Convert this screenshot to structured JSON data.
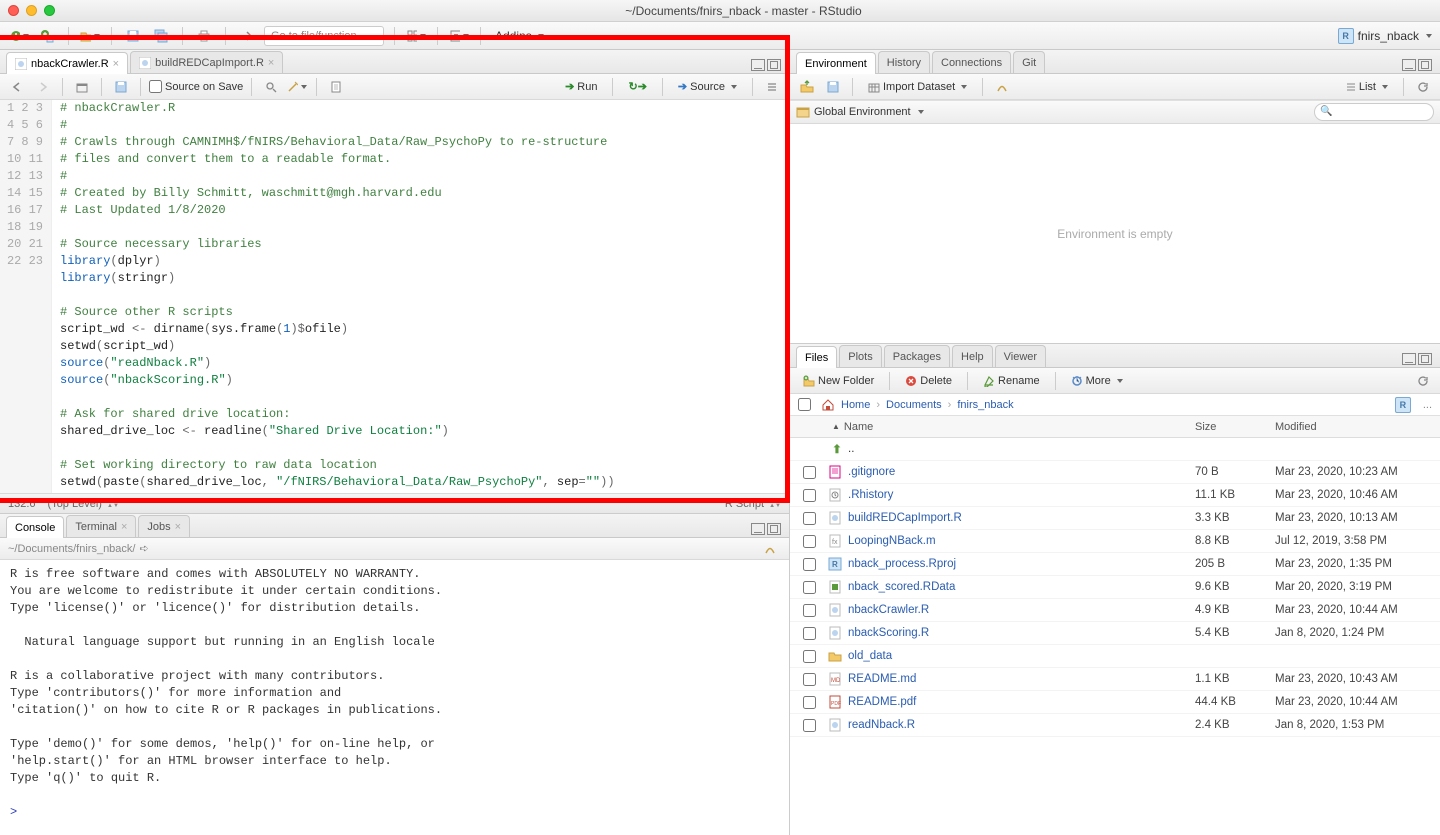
{
  "window": {
    "title": "~/Documents/fnirs_nback - master - RStudio"
  },
  "toolbar": {
    "gotofile_placeholder": "Go to file/function",
    "addins_label": "Addins",
    "project_name": "fnirs_nback"
  },
  "source": {
    "tabs": [
      {
        "label": "nbackCrawler.R",
        "active": true
      },
      {
        "label": "buildREDCapImport.R",
        "active": false
      }
    ],
    "sourceonsave_label": "Source on Save",
    "run_label": "Run",
    "source_label": "Source",
    "cursor_pos": "132:6",
    "scope_label": "(Top Level)",
    "filetype_label": "R Script",
    "lines": [
      {
        "n": 1,
        "tokens": [
          [
            "comment",
            "# nbackCrawler.R"
          ]
        ]
      },
      {
        "n": 2,
        "tokens": [
          [
            "comment",
            "#"
          ]
        ]
      },
      {
        "n": 3,
        "tokens": [
          [
            "comment",
            "# Crawls through CAMNIMH$/fNIRS/Behavioral_Data/Raw_PsychoPy to re-structure"
          ]
        ]
      },
      {
        "n": 4,
        "tokens": [
          [
            "comment",
            "# files and convert them to a readable format."
          ]
        ]
      },
      {
        "n": 5,
        "tokens": [
          [
            "comment",
            "#"
          ]
        ]
      },
      {
        "n": 6,
        "tokens": [
          [
            "comment",
            "# Created by Billy Schmitt, waschmitt@mgh.harvard.edu"
          ]
        ]
      },
      {
        "n": 7,
        "tokens": [
          [
            "comment",
            "# Last Updated 1/8/2020"
          ]
        ]
      },
      {
        "n": 8,
        "tokens": []
      },
      {
        "n": 9,
        "tokens": [
          [
            "comment",
            "# Source necessary libraries"
          ]
        ]
      },
      {
        "n": 10,
        "tokens": [
          [
            "keyword",
            "library"
          ],
          [
            "op",
            "("
          ],
          [
            "fn",
            "dplyr"
          ],
          [
            "op",
            ")"
          ]
        ]
      },
      {
        "n": 11,
        "tokens": [
          [
            "keyword",
            "library"
          ],
          [
            "op",
            "("
          ],
          [
            "fn",
            "stringr"
          ],
          [
            "op",
            ")"
          ]
        ]
      },
      {
        "n": 12,
        "tokens": []
      },
      {
        "n": 13,
        "tokens": [
          [
            "comment",
            "# Source other R scripts"
          ]
        ]
      },
      {
        "n": 14,
        "tokens": [
          [
            "fn",
            "script_wd "
          ],
          [
            "op",
            "<- "
          ],
          [
            "fn",
            "dirname"
          ],
          [
            "op",
            "("
          ],
          [
            "fn",
            "sys.frame"
          ],
          [
            "op",
            "("
          ],
          [
            "num",
            "1"
          ],
          [
            "op",
            ")"
          ],
          [
            "op",
            "$"
          ],
          [
            "fn",
            "ofile"
          ],
          [
            "op",
            ")"
          ]
        ]
      },
      {
        "n": 15,
        "tokens": [
          [
            "fn",
            "setwd"
          ],
          [
            "op",
            "("
          ],
          [
            "fn",
            "script_wd"
          ],
          [
            "op",
            ")"
          ]
        ]
      },
      {
        "n": 16,
        "tokens": [
          [
            "keyword",
            "source"
          ],
          [
            "op",
            "("
          ],
          [
            "string",
            "\"readNback.R\""
          ],
          [
            "op",
            ")"
          ]
        ]
      },
      {
        "n": 17,
        "tokens": [
          [
            "keyword",
            "source"
          ],
          [
            "op",
            "("
          ],
          [
            "string",
            "\"nbackScoring.R\""
          ],
          [
            "op",
            ")"
          ]
        ]
      },
      {
        "n": 18,
        "tokens": []
      },
      {
        "n": 19,
        "tokens": [
          [
            "comment",
            "# Ask for shared drive location:"
          ]
        ]
      },
      {
        "n": 20,
        "tokens": [
          [
            "fn",
            "shared_drive_loc "
          ],
          [
            "op",
            "<- "
          ],
          [
            "fn",
            "readline"
          ],
          [
            "op",
            "("
          ],
          [
            "string",
            "\"Shared Drive Location:\""
          ],
          [
            "op",
            ")"
          ]
        ]
      },
      {
        "n": 21,
        "tokens": []
      },
      {
        "n": 22,
        "tokens": [
          [
            "comment",
            "# Set working directory to raw data location"
          ]
        ]
      },
      {
        "n": 23,
        "tokens": [
          [
            "fn",
            "setwd"
          ],
          [
            "op",
            "("
          ],
          [
            "fn",
            "paste"
          ],
          [
            "op",
            "("
          ],
          [
            "fn",
            "shared_drive_loc"
          ],
          [
            "op",
            ", "
          ],
          [
            "string",
            "\"/fNIRS/Behavioral_Data/Raw_PsychoPy\""
          ],
          [
            "op",
            ", "
          ],
          [
            "fn",
            "sep"
          ],
          [
            "op",
            "="
          ],
          [
            "string",
            "\"\""
          ],
          [
            "op",
            "))"
          ]
        ]
      }
    ]
  },
  "console": {
    "tabs": [
      {
        "label": "Console",
        "active": true
      },
      {
        "label": "Terminal",
        "active": false
      },
      {
        "label": "Jobs",
        "active": false
      }
    ],
    "path": "~/Documents/fnirs_nback/",
    "body": "R is free software and comes with ABSOLUTELY NO WARRANTY.\nYou are welcome to redistribute it under certain conditions.\nType 'license()' or 'licence()' for distribution details.\n\n  Natural language support but running in an English locale\n\nR is a collaborative project with many contributors.\nType 'contributors()' for more information and\n'citation()' on how to cite R or R packages in publications.\n\nType 'demo()' for some demos, 'help()' for on-line help, or\n'help.start()' for an HTML browser interface to help.\nType 'q()' to quit R.\n",
    "prompt": "> "
  },
  "env": {
    "tabs": [
      {
        "label": "Environment",
        "active": true
      },
      {
        "label": "History",
        "active": false
      },
      {
        "label": "Connections",
        "active": false
      },
      {
        "label": "Git",
        "active": false
      }
    ],
    "import_label": "Import Dataset",
    "list_label": "List",
    "scope_label": "Global Environment",
    "empty_text": "Environment is empty"
  },
  "files": {
    "tabs": [
      {
        "label": "Files",
        "active": true
      },
      {
        "label": "Plots",
        "active": false
      },
      {
        "label": "Packages",
        "active": false
      },
      {
        "label": "Help",
        "active": false
      },
      {
        "label": "Viewer",
        "active": false
      }
    ],
    "newfolder_label": "New Folder",
    "delete_label": "Delete",
    "rename_label": "Rename",
    "more_label": "More",
    "breadcrumb": [
      "Home",
      "Documents",
      "fnirs_nback"
    ],
    "header": {
      "name": "Name",
      "size": "Size",
      "modified": "Modified"
    },
    "uprow": "..",
    "rows": [
      {
        "icon": "txt",
        "name": ".gitignore",
        "size": "70 B",
        "modified": "Mar 23, 2020, 10:23 AM"
      },
      {
        "icon": "rhist",
        "name": ".Rhistory",
        "size": "11.1 KB",
        "modified": "Mar 23, 2020, 10:46 AM"
      },
      {
        "icon": "r",
        "name": "buildREDCapImport.R",
        "size": "3.3 KB",
        "modified": "Mar 23, 2020, 10:13 AM"
      },
      {
        "icon": "m",
        "name": "LoopingNBack.m",
        "size": "8.8 KB",
        "modified": "Jul 12, 2019, 3:58 PM"
      },
      {
        "icon": "rproj",
        "name": "nback_process.Rproj",
        "size": "205 B",
        "modified": "Mar 23, 2020, 1:35 PM"
      },
      {
        "icon": "rdata",
        "name": "nback_scored.RData",
        "size": "9.6 KB",
        "modified": "Mar 20, 2020, 3:19 PM"
      },
      {
        "icon": "r",
        "name": "nbackCrawler.R",
        "size": "4.9 KB",
        "modified": "Mar 23, 2020, 10:44 AM"
      },
      {
        "icon": "r",
        "name": "nbackScoring.R",
        "size": "5.4 KB",
        "modified": "Jan 8, 2020, 1:24 PM"
      },
      {
        "icon": "folder",
        "name": "old_data",
        "size": "",
        "modified": ""
      },
      {
        "icon": "md",
        "name": "README.md",
        "size": "1.1 KB",
        "modified": "Mar 23, 2020, 10:43 AM"
      },
      {
        "icon": "pdf",
        "name": "README.pdf",
        "size": "44.4 KB",
        "modified": "Mar 23, 2020, 10:44 AM"
      },
      {
        "icon": "r",
        "name": "readNback.R",
        "size": "2.4 KB",
        "modified": "Jan 8, 2020, 1:53 PM"
      }
    ]
  }
}
